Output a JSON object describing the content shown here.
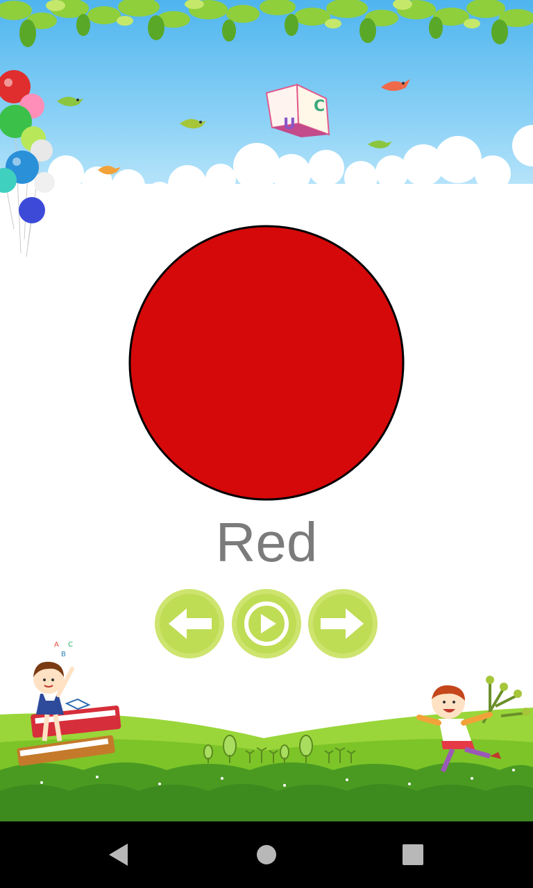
{
  "lesson": {
    "color_name": "Red",
    "swatch_color": "#d50909"
  },
  "controls": {
    "previous_icon": "arrow-left-icon",
    "play_icon": "play-icon",
    "next_icon": "arrow-right-icon",
    "accent": "#bfdc55"
  },
  "navbar": {
    "back_icon": "triangle-back-icon",
    "home_icon": "circle-home-icon",
    "recents_icon": "square-recents-icon"
  },
  "decor": {
    "sky_book_letters": [
      "U",
      "C"
    ]
  }
}
